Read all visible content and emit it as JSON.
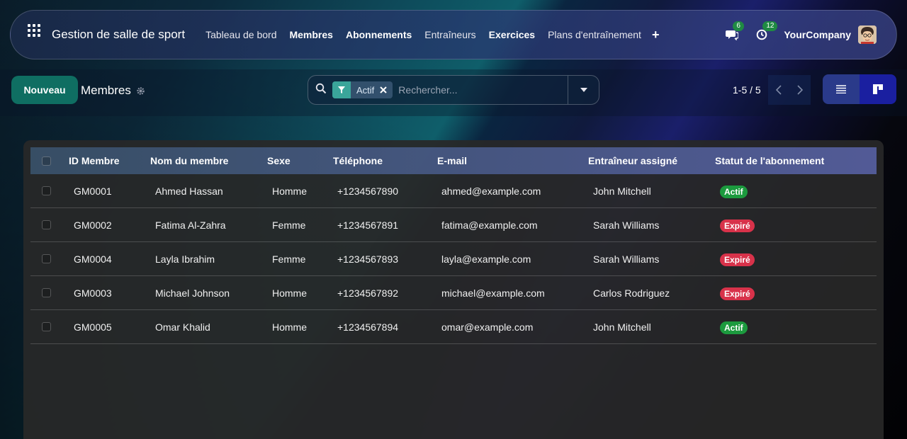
{
  "navbar": {
    "app_title": "Gestion de salle de sport",
    "menu": [
      {
        "label": "Tableau de bord",
        "bold": false
      },
      {
        "label": "Membres",
        "bold": true
      },
      {
        "label": "Abonnements",
        "bold": true
      },
      {
        "label": "Entraîneurs",
        "bold": false
      },
      {
        "label": "Exercices",
        "bold": true
      },
      {
        "label": "Plans d'entraînement",
        "bold": false
      }
    ],
    "plus": "+",
    "messages_count": "6",
    "activities_count": "12",
    "company": "YourCompany"
  },
  "control_panel": {
    "new_button": "Nouveau",
    "page_title": "Membres",
    "search": {
      "facet_label": "Actif",
      "placeholder": "Rechercher..."
    },
    "pager": "1-5 / 5"
  },
  "table": {
    "columns": [
      "ID Membre",
      "Nom du membre",
      "Sexe",
      "Téléphone",
      "E-mail",
      "Entraîneur assigné",
      "Statut de l'abonnement"
    ],
    "rows": [
      {
        "id": "GM0001",
        "name": "Ahmed Hassan",
        "sex": "Homme",
        "phone": "+1234567890",
        "email": "ahmed@example.com",
        "trainer": "John Mitchell",
        "status": "Actif",
        "status_kind": "active"
      },
      {
        "id": "GM0002",
        "name": "Fatima Al-Zahra",
        "sex": "Femme",
        "phone": "+1234567891",
        "email": "fatima@example.com",
        "trainer": "Sarah Williams",
        "status": "Expiré",
        "status_kind": "expired"
      },
      {
        "id": "GM0004",
        "name": "Layla Ibrahim",
        "sex": "Femme",
        "phone": "+1234567893",
        "email": "layla@example.com",
        "trainer": "Sarah Williams",
        "status": "Expiré",
        "status_kind": "expired"
      },
      {
        "id": "GM0003",
        "name": "Michael Johnson",
        "sex": "Homme",
        "phone": "+1234567892",
        "email": "michael@example.com",
        "trainer": "Carlos Rodriguez",
        "status": "Expiré",
        "status_kind": "expired"
      },
      {
        "id": "GM0005",
        "name": "Omar Khalid",
        "sex": "Homme",
        "phone": "+1234567894",
        "email": "omar@example.com",
        "trainer": "John Mitchell",
        "status": "Actif",
        "status_kind": "active"
      }
    ]
  },
  "colors": {
    "primary": "#0f6e62",
    "active": "#1c9a3e",
    "expired": "#d8324a",
    "badge": "#1f8a43"
  }
}
